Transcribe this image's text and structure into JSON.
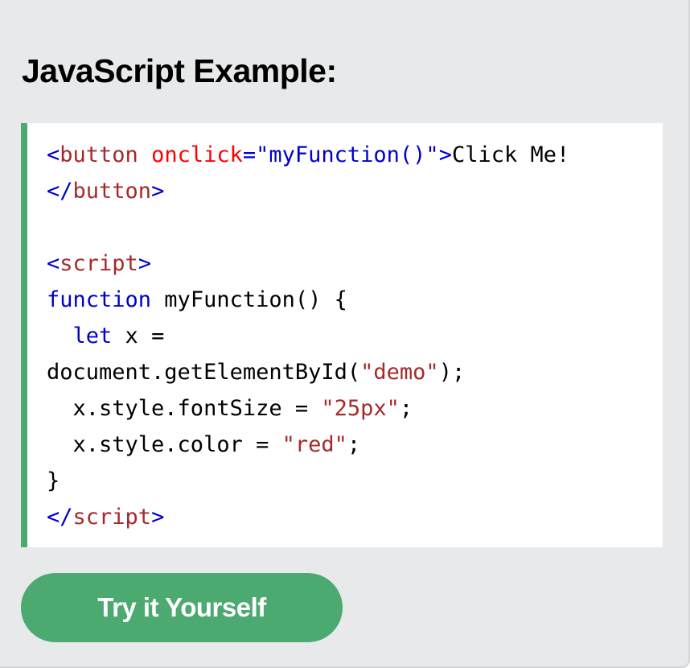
{
  "example": {
    "heading": "JavaScript Example:",
    "code_lines": [
      [
        {
          "t": "<",
          "c": "tag"
        },
        {
          "t": "button",
          "c": "tname"
        },
        {
          "t": " onclick",
          "c": "attr"
        },
        {
          "t": "=\"myFunction()\"",
          "c": "aval"
        },
        {
          "t": ">",
          "c": "tag"
        },
        {
          "t": "Click Me!",
          "c": "plain"
        }
      ],
      [
        {
          "t": "</",
          "c": "tag"
        },
        {
          "t": "button",
          "c": "tname"
        },
        {
          "t": ">",
          "c": "tag"
        }
      ],
      [],
      [
        {
          "t": "<",
          "c": "tag"
        },
        {
          "t": "script",
          "c": "tname"
        },
        {
          "t": ">",
          "c": "tag"
        }
      ],
      [
        {
          "t": "function",
          "c": "kw"
        },
        {
          "t": " myFunction() {",
          "c": "plain"
        }
      ],
      [
        {
          "t": "  ",
          "c": "plain"
        },
        {
          "t": "let",
          "c": "kw"
        },
        {
          "t": " x =",
          "c": "plain"
        }
      ],
      [
        {
          "t": "document.getElementById(",
          "c": "plain"
        },
        {
          "t": "\"demo\"",
          "c": "str"
        },
        {
          "t": ");",
          "c": "plain"
        }
      ],
      [
        {
          "t": "  x.style.fontSize = ",
          "c": "plain"
        },
        {
          "t": "\"25px\"",
          "c": "str"
        },
        {
          "t": ";",
          "c": "plain"
        }
      ],
      [
        {
          "t": "  x.style.color = ",
          "c": "plain"
        },
        {
          "t": "\"red\"",
          "c": "str"
        },
        {
          "t": ";",
          "c": "plain"
        }
      ],
      [
        {
          "t": "}",
          "c": "plain"
        }
      ],
      [
        {
          "t": "</",
          "c": "tag"
        },
        {
          "t": "script",
          "c": "tname"
        },
        {
          "t": ">",
          "c": "tag"
        }
      ]
    ],
    "try_button_label": "Try it Yourself"
  },
  "colors": {
    "panel_bg": "#e7e9eb",
    "accent_green": "#4caa71",
    "tag_blue": "#0000cd",
    "tag_name_brown": "#a52a2a",
    "attribute_red": "#ff0000",
    "keyword_blue": "#0000cd",
    "string_brown": "#a52a2a"
  }
}
